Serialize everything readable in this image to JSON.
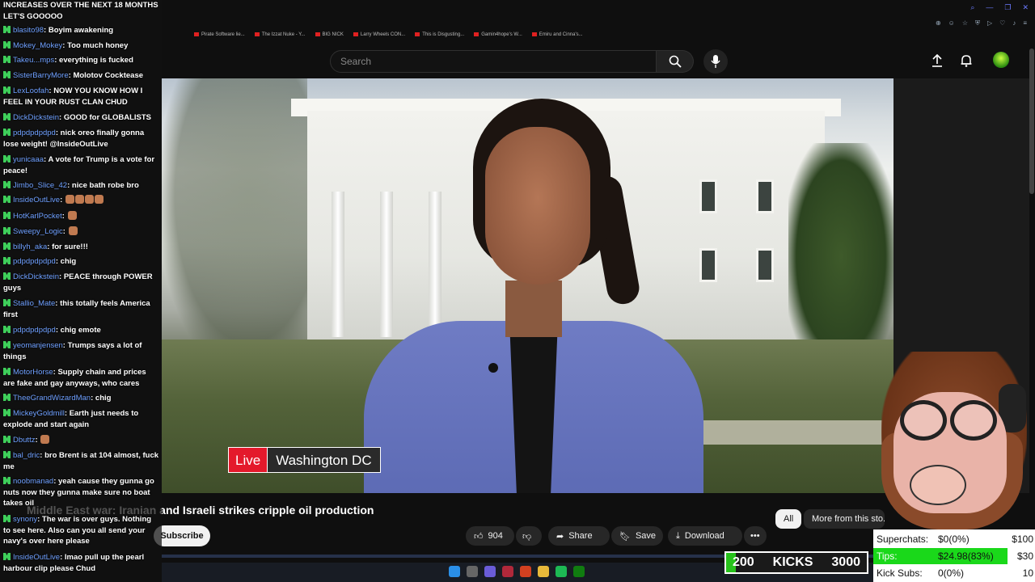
{
  "browser": {
    "bookmarks": [
      "Pirate Software lie...",
      "The Izzat Nuke - Y...",
      "BIG NICK",
      "Larry Wheels CON...",
      "This is Disgusting...",
      "Gamin4hope's W...",
      "Emiru and Cinna's..."
    ]
  },
  "header": {
    "search_placeholder": "Search"
  },
  "video": {
    "live_label": "Live",
    "location_label": "Washington DC",
    "title": "Middle East war: Iranian and Israeli strikes cripple oil production"
  },
  "actions": {
    "subscribe_label": "Subscribe",
    "like_count": "904",
    "share_label": "Share",
    "save_label": "Save",
    "download_label": "Download"
  },
  "chips": {
    "all_label": "All",
    "more_label": "More from this sto..."
  },
  "chat": {
    "top_text": "INCREASES OVER THE NEXT 18 MONTHS LET'S GOOOOO",
    "messages": [
      {
        "user": "blasito98",
        "text": "Boyim awakening"
      },
      {
        "user": "Mokey_Mokey",
        "text": "Too much honey"
      },
      {
        "user": "Takeu...mps",
        "text": "everything is fucked"
      },
      {
        "user": "SisterBarryMore",
        "text": "Molotov Cocktease"
      },
      {
        "user": "LexLoofah",
        "text": "NOW YOU KNOW HOW I FEEL IN YOUR RUST CLAN CHUD"
      },
      {
        "user": "DickDickstein",
        "text": "GOOD for GLOBALISTS"
      },
      {
        "user": "pdpdpdpdpd",
        "text": "nick oreo finally gonna lose weight! @InsideOutLive"
      },
      {
        "user": "yunicaaa",
        "text": "A vote for Trump is a vote for peace!"
      },
      {
        "user": "Jimbo_Slice_42",
        "text": "nice bath robe bro"
      },
      {
        "user": "InsideOutLive",
        "text": ""
      },
      {
        "user": "HotKarlPocket",
        "text": ""
      },
      {
        "user": "Sweepy_Logic",
        "text": ""
      },
      {
        "user": "billyh_aka",
        "text": "for sure!!!"
      },
      {
        "user": "pdpdpdpdpd",
        "text": "chig"
      },
      {
        "user": "DickDickstein",
        "text": "PEACE through POWER guys"
      },
      {
        "user": "Stallio_Mate",
        "text": "this totally feels America first"
      },
      {
        "user": "pdpdpdpdpd",
        "text": "chig emote"
      },
      {
        "user": "yeomanjensen",
        "text": "Trumps says a lot of things"
      },
      {
        "user": "MotorHorse",
        "text": "Supply chain and prices are fake and gay anyways, who cares"
      },
      {
        "user": "TheeGrandWizardMan",
        "text": "chig"
      },
      {
        "user": "MickeyGoldmill",
        "text": "Earth just needs to explode and start again"
      },
      {
        "user": "Dbuttz",
        "text": ""
      },
      {
        "user": "bal_dric",
        "text": "bro Brent is at 104 almost, fuck me"
      },
      {
        "user": "noobmanad",
        "text": "yeah cause they gunna go nuts now they gunna make sure no boat takes oil"
      },
      {
        "user": "synony",
        "text": "The war is over guys. Nothing to see here. Also can you all send your navy's over here please"
      },
      {
        "user": "InsideOutLive",
        "text": "lmao pull up the pearl harbour clip please Chud"
      }
    ]
  },
  "kicks": {
    "current": "200",
    "label": "KICKS",
    "goal": "3000",
    "progress_fraction": 0.0667
  },
  "goals": {
    "rows": [
      {
        "label": "Superchats:",
        "value": "$0(0%)",
        "target": "$100",
        "fraction": 0
      },
      {
        "label": "Tips:",
        "value": "$24.98(83%)",
        "target": "$30",
        "fraction": 0.83
      },
      {
        "label": "Kick Subs:",
        "value": "0(0%)",
        "target": "10",
        "fraction": 0
      }
    ]
  },
  "colors": {
    "live_red": "#e4192b",
    "chat_badge_green": "#3ecf5a",
    "username_blue": "#6fa0ff",
    "goal_green": "#1ad81a"
  }
}
